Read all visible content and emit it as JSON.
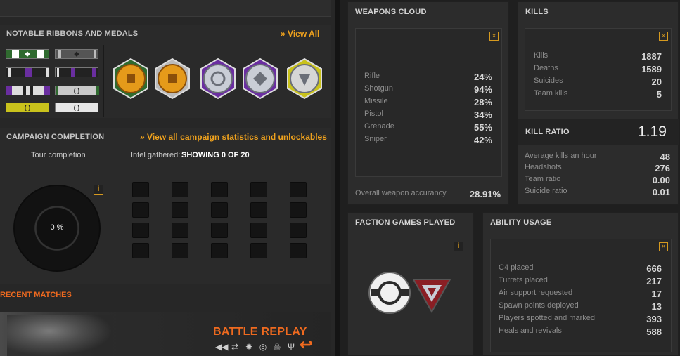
{
  "ribbons_section": {
    "title": "NOTABLE RIBBONS AND MEDALS",
    "link": "View All",
    "link_arrows": "»"
  },
  "campaign_section": {
    "title": "CAMPAIGN COMPLETION",
    "link": "View all campaign statistics and unlockables",
    "link_arrows": "»",
    "tour_label": "Tour completion",
    "tour_value": "0 %",
    "intel_label": "Intel gathered:",
    "intel_value": "SHOWING 0 OF 20",
    "info_glyph": "i"
  },
  "recent_matches": {
    "title": "RECENT MATCHES",
    "banner_title": "BATTLE REPLAY"
  },
  "weapons_cloud": {
    "title": "WEAPONS CLOUD",
    "close_glyph": "×",
    "rows": [
      {
        "label": "Rifle",
        "value": "24%"
      },
      {
        "label": "Shotgun",
        "value": "94%"
      },
      {
        "label": "Missile",
        "value": "28%"
      },
      {
        "label": "Pistol",
        "value": "34%"
      },
      {
        "label": "Grenade",
        "value": "55%"
      },
      {
        "label": "Sniper",
        "value": "42%"
      }
    ],
    "overall_label": "Overall weapon accurancy",
    "overall_value": "28.91%"
  },
  "kills": {
    "title": "KILLS",
    "close_glyph": "×",
    "rows": [
      {
        "label": "Kills",
        "value": "1887"
      },
      {
        "label": "Deaths",
        "value": "1589"
      },
      {
        "label": "Suicides",
        "value": "20"
      },
      {
        "label": "Team kills",
        "value": "5"
      }
    ],
    "ratio_title": "KILL RATIO",
    "ratio_value": "1.19",
    "ratio_rows": [
      {
        "label": "Average kills an hour",
        "value": "48"
      },
      {
        "label": "Headshots",
        "value": "276"
      },
      {
        "label": "Team ratio",
        "value": "0.00"
      },
      {
        "label": "Suicide ratio",
        "value": "0.01"
      }
    ]
  },
  "faction": {
    "title": "FACTION GAMES PLAYED",
    "info_glyph": "i"
  },
  "ability": {
    "title": "ABILITY USAGE",
    "close_glyph": "×",
    "rows": [
      {
        "label": "C4 placed",
        "value": "666"
      },
      {
        "label": "Turrets placed",
        "value": "217"
      },
      {
        "label": "Air support requested",
        "value": "17"
      },
      {
        "label": "Spawn points deployed",
        "value": "13"
      },
      {
        "label": "Players spotted and marked",
        "value": "393"
      },
      {
        "label": "Heals and revivals",
        "value": "588"
      }
    ]
  },
  "colors": {
    "accent_orange": "#f0a21d",
    "recent_orange": "#ef6a1f",
    "purple": "#6a2ea0",
    "yellow": "#c9c21c"
  }
}
